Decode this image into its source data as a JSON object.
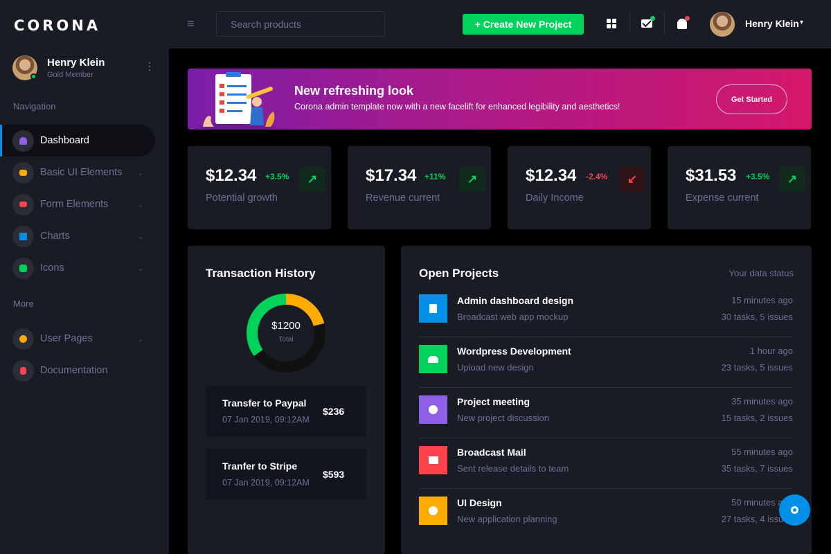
{
  "brand": {
    "name": "CORONA"
  },
  "user": {
    "name": "Henry Klein",
    "role": "Gold Member",
    "menu_icon": "ellipsis-vertical-icon"
  },
  "sidebar": {
    "heading_navigation": "Navigation",
    "heading_more": "More",
    "items": [
      {
        "label": "Dashboard",
        "icon": "speedometer-icon",
        "color": "#8f5fe8",
        "active": true
      },
      {
        "label": "Basic UI Elements",
        "icon": "laptop-icon",
        "color": "#ffab00",
        "caret": "⌄"
      },
      {
        "label": "Form Elements",
        "icon": "playlist-icon",
        "color": "#fc424a",
        "caret": "⌄"
      },
      {
        "label": "Charts",
        "icon": "chart-bar-icon",
        "color": "#0090e7",
        "caret": "⌄"
      },
      {
        "label": "Icons",
        "icon": "contacts-icon",
        "color": "#00d25b",
        "caret": "⌄"
      }
    ],
    "more_items": [
      {
        "label": "User Pages",
        "icon": "security-icon",
        "color": "#ffab00",
        "caret": "⌄"
      },
      {
        "label": "Documentation",
        "icon": "file-document-icon",
        "color": "#fc424a"
      }
    ]
  },
  "topbar": {
    "menu_icon": "≡",
    "search_placeholder": "Search products",
    "create_button": "+ Create New Project",
    "user_name": "Henry Klein",
    "user_caret": "▾",
    "mail_badge_color": "#00d25b",
    "bell_badge_color": "#fc424a"
  },
  "banner": {
    "title": "New refreshing look",
    "subtitle": "Corona admin template now with a new facelift for enhanced legibility and aesthetics!",
    "button": "Get Started"
  },
  "stats": [
    {
      "value": "$12.34",
      "change": "+3.5%",
      "label": "Potential growth",
      "trend": "up",
      "arrow": "↗",
      "color": "#00d25b",
      "bg": "#12291d"
    },
    {
      "value": "$17.34",
      "change": "+11%",
      "label": "Revenue current",
      "trend": "up",
      "arrow": "↗",
      "color": "#00d25b",
      "bg": "#12291d"
    },
    {
      "value": "$12.34",
      "change": "-2.4%",
      "label": "Daily Income",
      "trend": "down",
      "arrow": "↙",
      "color": "#fc424a",
      "bg": "#2e1518"
    },
    {
      "value": "$31.53",
      "change": "+3.5%",
      "label": "Expense current",
      "trend": "up",
      "arrow": "↗",
      "color": "#00d25b",
      "bg": "#12291d"
    }
  ],
  "transactions": {
    "title": "Transaction History",
    "donut": {
      "total": "$1200",
      "label": "Total",
      "segments": [
        {
          "color": "#ffab00",
          "fraction": 0.21
        },
        {
          "color": "#111111",
          "fraction": 0.44
        },
        {
          "color": "#00d25b",
          "fraction": 0.35
        }
      ]
    },
    "items": [
      {
        "title": "Transfer to Paypal",
        "date": "07 Jan 2019, 09:12AM",
        "amount": "$236"
      },
      {
        "title": "Tranfer to Stripe",
        "date": "07 Jan 2019, 09:12AM",
        "amount": "$593"
      }
    ]
  },
  "projects": {
    "title": "Open Projects",
    "status_label": "Your data status",
    "items": [
      {
        "title": "Admin dashboard design",
        "desc": "Broadcast web app mockup",
        "time": "15 minutes ago",
        "tasks": "30 tasks, 5 issues",
        "icon": "file-icon",
        "color": "#0090e7"
      },
      {
        "title": "Wordpress Development",
        "desc": "Upload new design",
        "time": "1 hour ago",
        "tasks": "23 tasks, 5 issues",
        "icon": "cloud-upload-icon",
        "color": "#00d25b"
      },
      {
        "title": "Project meeting",
        "desc": "New project discussion",
        "time": "35 minutes ago",
        "tasks": "15 tasks, 2 issues",
        "icon": "clock-icon",
        "color": "#8f5fe8"
      },
      {
        "title": "Broadcast Mail",
        "desc": "Sent release details to team",
        "time": "55 minutes ago",
        "tasks": "35 tasks, 7 issues",
        "icon": "mail-open-icon",
        "color": "#fc424a"
      },
      {
        "title": "UI Design",
        "desc": "New application planning",
        "time": "50 minutes ago",
        "tasks": "27 tasks, 4 issues",
        "icon": "chart-pie-icon",
        "color": "#ffab00"
      }
    ]
  },
  "fab": {
    "icon": "settings-icon",
    "color": "#0090e7"
  }
}
